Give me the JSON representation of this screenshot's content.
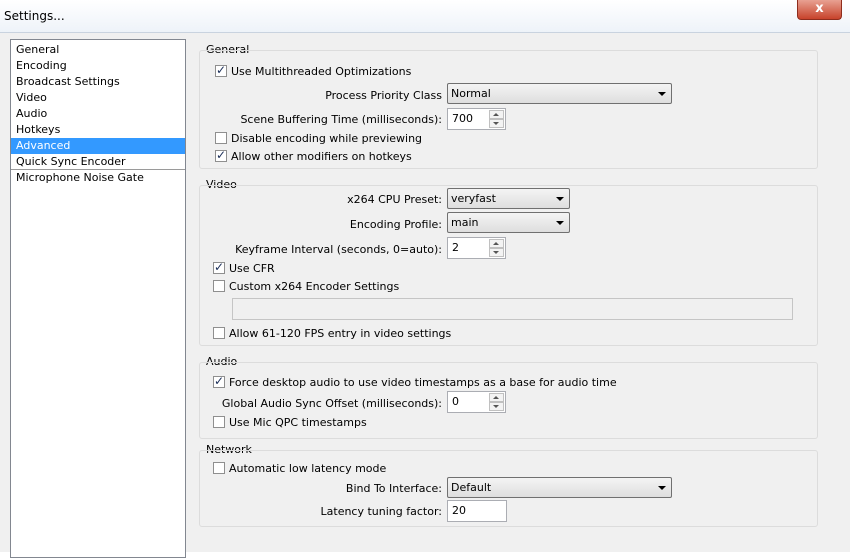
{
  "window": {
    "title": "Settings...",
    "close_glyph": "x"
  },
  "sidebar": {
    "items": [
      {
        "label": "General"
      },
      {
        "label": "Encoding"
      },
      {
        "label": "Broadcast Settings"
      },
      {
        "label": "Video"
      },
      {
        "label": "Audio"
      },
      {
        "label": "Hotkeys"
      },
      {
        "label": "Advanced",
        "selected": true
      },
      {
        "label": "Quick Sync Encoder"
      },
      {
        "label": "Microphone Noise Gate"
      }
    ]
  },
  "general": {
    "group_title": "General",
    "multithreaded": {
      "label": "Use Multithreaded Optimizations",
      "checked": true
    },
    "priority": {
      "label": "Process Priority Class",
      "value": "Normal"
    },
    "buffering": {
      "label": "Scene Buffering Time (milliseconds):",
      "value": "700"
    },
    "disable_preview": {
      "label": "Disable encoding while previewing",
      "checked": false
    },
    "modifiers": {
      "label": "Allow other modifiers on hotkeys",
      "checked": true
    }
  },
  "video": {
    "group_title": "Video",
    "preset": {
      "label": "x264 CPU Preset:",
      "value": "veryfast"
    },
    "profile": {
      "label": "Encoding Profile:",
      "value": "main"
    },
    "keyframe": {
      "label": "Keyframe Interval (seconds, 0=auto):",
      "value": "2"
    },
    "cfr": {
      "label": "Use CFR",
      "checked": true
    },
    "custom_x264": {
      "label": "Custom x264 Encoder Settings",
      "checked": false,
      "value": ""
    },
    "fps_entry": {
      "label": "Allow 61-120 FPS entry in video settings",
      "checked": false
    }
  },
  "audio": {
    "group_title": "Audio",
    "force_timestamps": {
      "label": "Force desktop audio to use video timestamps as a base for audio time",
      "checked": true
    },
    "sync_offset": {
      "label": "Global Audio Sync Offset (milliseconds):",
      "value": "0"
    },
    "mic_qpc": {
      "label": "Use Mic QPC timestamps",
      "checked": false
    }
  },
  "network": {
    "group_title": "Network",
    "low_latency": {
      "label": "Automatic low latency mode",
      "checked": false
    },
    "bind_interface": {
      "label": "Bind To Interface:",
      "value": "Default"
    },
    "latency_factor": {
      "label": "Latency tuning factor:",
      "value": "20"
    }
  }
}
